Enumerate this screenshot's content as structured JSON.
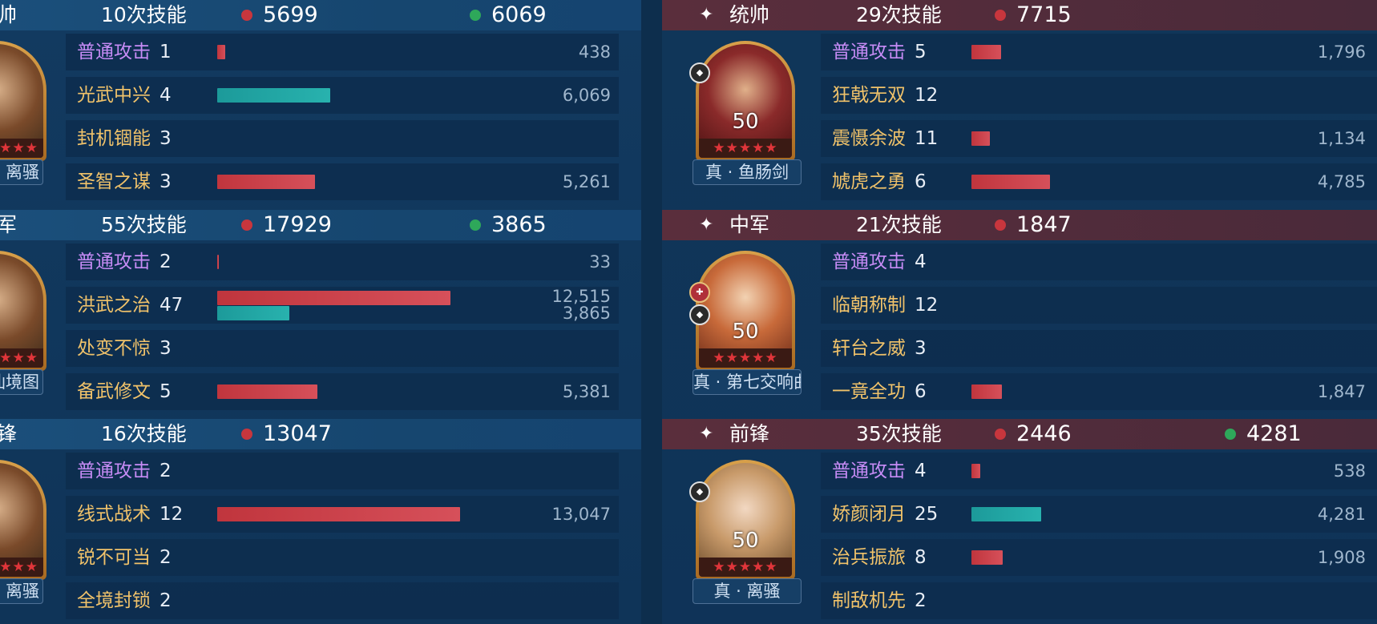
{
  "colors": {
    "damage": "#c8363d",
    "heal": "#2ea85a",
    "basic_attack": "#c78cf6",
    "skill": "#f0c26a"
  },
  "left": {
    "sections": [
      {
        "role": "帅",
        "casts": "10次技能",
        "damage": "5699",
        "heal": "6069",
        "equip": "离骚",
        "skills": [
          {
            "name": "普通攻击",
            "count": "1",
            "value": "438",
            "damage_pct": 0.019
          },
          {
            "name": "光武中兴",
            "count": "4",
            "value": "6,069",
            "heal_pct": 0.262
          },
          {
            "name": "封机锢能",
            "count": "3"
          },
          {
            "name": "圣智之谋",
            "count": "3",
            "value": "5,261",
            "damage_pct": 0.227
          }
        ]
      },
      {
        "role": "军",
        "casts": "55次技能",
        "damage": "17929",
        "heal": "3865",
        "equip": "原仙境图",
        "skills": [
          {
            "name": "普通攻击",
            "count": "2",
            "value": "33",
            "damage_pct": 0.002
          },
          {
            "name": "洪武之治",
            "count": "47",
            "value": "12,515",
            "value2": "3,865",
            "damage_pct": 0.541,
            "heal_pct": 0.167
          },
          {
            "name": "处变不惊",
            "count": "3"
          },
          {
            "name": "备武修文",
            "count": "5",
            "value": "5,381",
            "damage_pct": 0.233
          }
        ]
      },
      {
        "role": "锋",
        "casts": "16次技能",
        "damage": "13047",
        "equip": "离骚",
        "skills": [
          {
            "name": "普通攻击",
            "count": "2"
          },
          {
            "name": "线式战术",
            "count": "12",
            "value": "13,047",
            "damage_pct": 0.564
          },
          {
            "name": "锐不可当",
            "count": "2"
          },
          {
            "name": "全境封锁",
            "count": "2"
          }
        ]
      }
    ]
  },
  "right": {
    "sections": [
      {
        "role": "统帅",
        "casts": "29次技能",
        "damage": "7715",
        "level": "50",
        "stars": "★★★★★",
        "equip": "真 · 鱼肠剑",
        "skills": [
          {
            "name": "普通攻击",
            "count": "5",
            "value": "1,796",
            "damage_pct": 0.078
          },
          {
            "name": "狂戟无双",
            "count": "12"
          },
          {
            "name": "震慑余波",
            "count": "11",
            "value": "1,134",
            "damage_pct": 0.049
          },
          {
            "name": "虓虎之勇",
            "count": "6",
            "value": "4,785",
            "damage_pct": 0.207
          }
        ]
      },
      {
        "role": "中军",
        "casts": "21次技能",
        "damage": "1847",
        "level": "50",
        "stars": "★★★★★",
        "equip": "真 · 第七交响曲",
        "skills": [
          {
            "name": "普通攻击",
            "count": "4"
          },
          {
            "name": "临朝称制",
            "count": "12"
          },
          {
            "name": "轩台之威",
            "count": "3"
          },
          {
            "name": "一竟全功",
            "count": "6",
            "value": "1,847",
            "damage_pct": 0.08
          }
        ]
      },
      {
        "role": "前锋",
        "casts": "35次技能",
        "damage": "2446",
        "heal": "4281",
        "level": "50",
        "stars": "★★★★★",
        "equip": "真 · 离骚",
        "skills": [
          {
            "name": "普通攻击",
            "count": "4",
            "value": "538",
            "damage_pct": 0.023
          },
          {
            "name": "娇颜闭月",
            "count": "25",
            "value": "4,281",
            "heal_pct": 0.185
          },
          {
            "name": "治兵振旅",
            "count": "8",
            "value": "1,908",
            "damage_pct": 0.082
          },
          {
            "name": "制敌机先",
            "count": "2"
          }
        ]
      }
    ]
  }
}
